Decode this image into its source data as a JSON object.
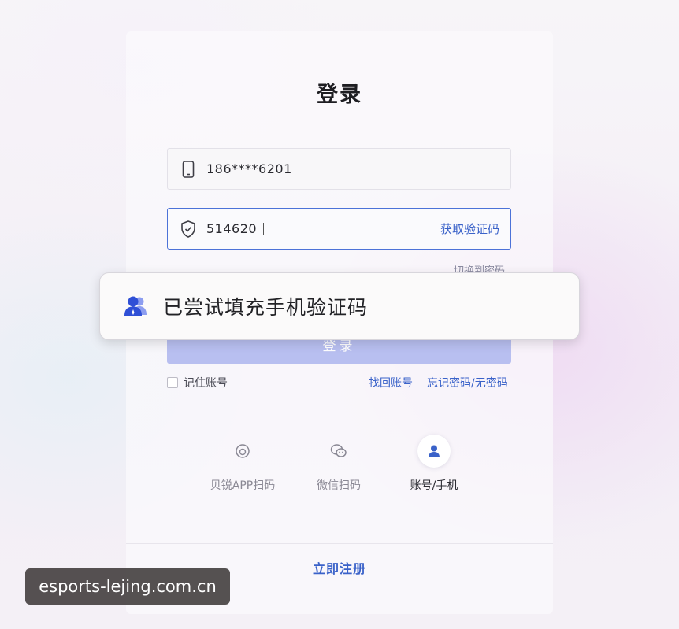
{
  "login": {
    "title": "登录",
    "phone_value": "186****6201",
    "code_value": "514620",
    "get_code_label": "获取验证码",
    "switch_to_password_label": "切换到密码",
    "login_button_label": "登录",
    "remember_label": "记住账号",
    "find_account_label": "找回账号",
    "forgot_password_label": "忘记密码/无密码",
    "register_label": "立即注册"
  },
  "toast": {
    "text": "已尝试填充手机验证码",
    "icon": "user-group-icon"
  },
  "login_methods": [
    {
      "label": "贝锐APP扫码",
      "icon": "app-scan-icon",
      "active": false
    },
    {
      "label": "微信扫码",
      "icon": "wechat-icon",
      "active": false
    },
    {
      "label": "账号/手机",
      "icon": "user-icon",
      "active": true
    }
  ],
  "watermark": {
    "text": "esports-lejing.com.cn"
  },
  "colors": {
    "accent": "#3a62c9",
    "focus_border": "#4c72d8",
    "login_button": "#b8bff0"
  }
}
